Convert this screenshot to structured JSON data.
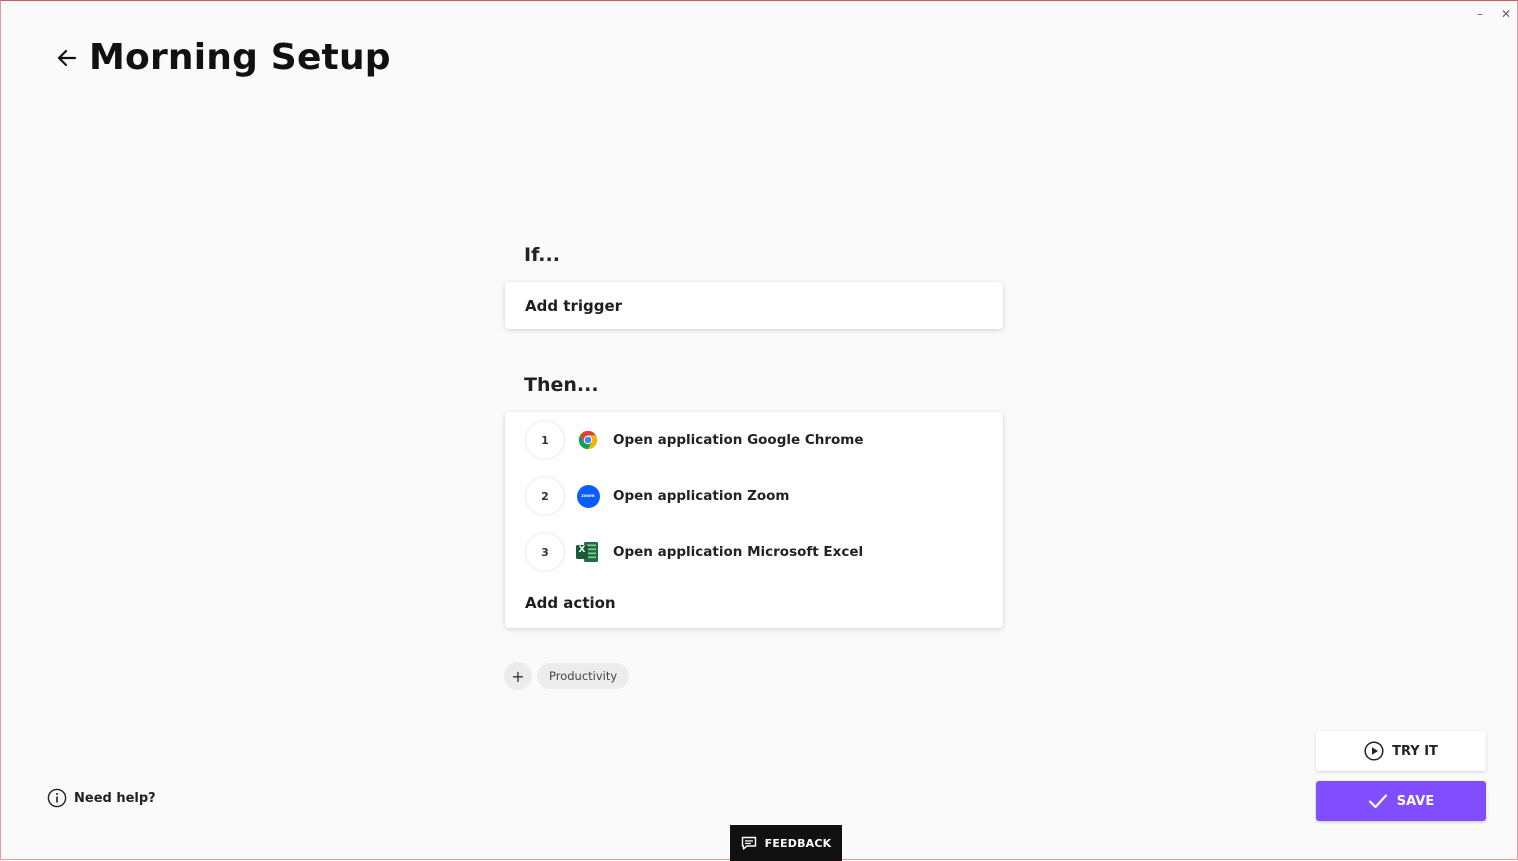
{
  "window": {
    "minimize_glyph": "–",
    "close_glyph": "✕"
  },
  "header": {
    "title": "Morning Setup",
    "back_icon": "arrow-left-icon"
  },
  "if_section": {
    "label": "If...",
    "trigger_placeholder": "Add trigger"
  },
  "then_section": {
    "label": "Then...",
    "actions": [
      {
        "number": "1",
        "text": "Open application Google Chrome",
        "icon": "chrome-icon"
      },
      {
        "number": "2",
        "text": "Open application Zoom",
        "icon": "zoom-icon",
        "icon_label": "zoom"
      },
      {
        "number": "3",
        "text": "Open application Microsoft Excel",
        "icon": "excel-icon",
        "icon_label": "X"
      }
    ],
    "add_action_label": "Add action"
  },
  "tags": {
    "add_glyph": "+",
    "items": [
      "Productivity"
    ]
  },
  "help": {
    "label": "Need help?",
    "icon": "info-icon"
  },
  "feedback": {
    "label": "FEEDBACK"
  },
  "buttons": {
    "try_label": "TRY IT",
    "save_label": "SAVE"
  },
  "colors": {
    "accent": "#814eff",
    "feedback_bg": "#111111",
    "zoom_blue": "#0b5cff",
    "excel_green": "#1d6f42"
  }
}
